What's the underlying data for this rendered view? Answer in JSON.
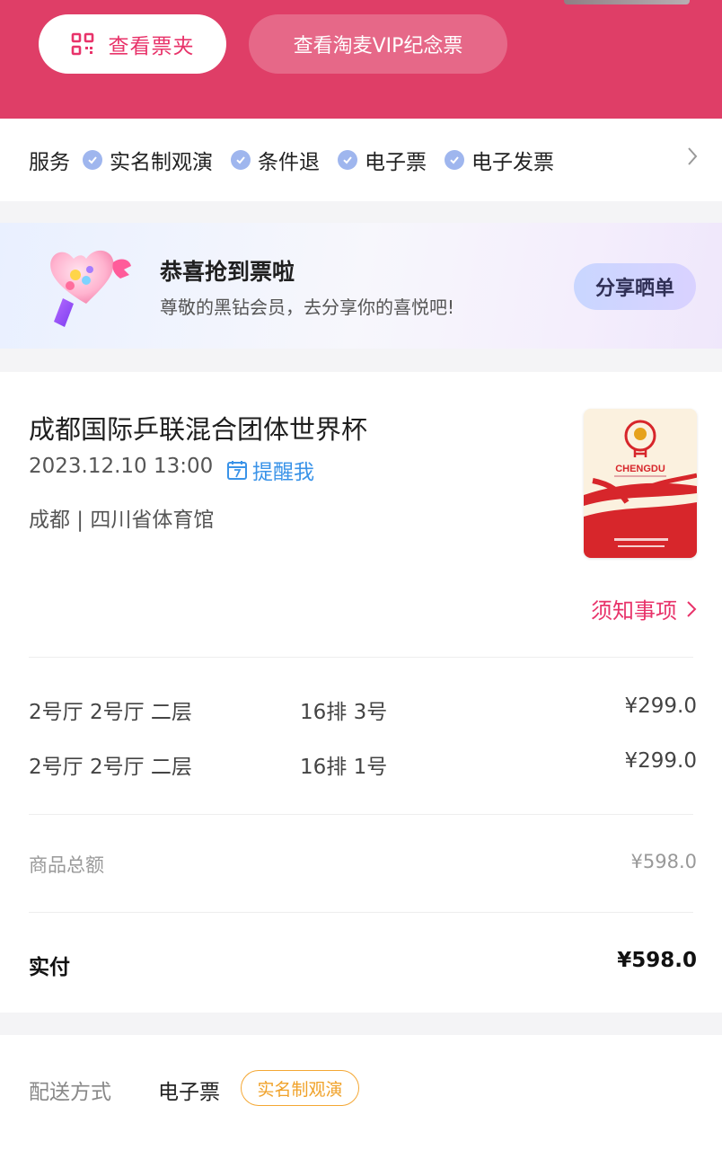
{
  "header": {
    "ticket_folder_label": "查看票夹",
    "vip_ticket_label": "查看淘麦VIP纪念票",
    "accent_color": "#df3e67"
  },
  "services": {
    "label": "服务",
    "items": [
      "实名制观演",
      "条件退",
      "电子票",
      "电子发票"
    ]
  },
  "banner": {
    "title": "恭喜抢到票啦",
    "subtitle": "尊敬的黑钻会员，去分享你的喜悦吧!",
    "share_label": "分享晒单"
  },
  "event": {
    "title": "成都国际乒联混合团体世界杯",
    "datetime": "2023.12.10 13:00",
    "remind_label": "提醒我",
    "venue": "成都 | 四川省体育馆",
    "poster_city": "CHENGDU",
    "notice_label": "须知事项"
  },
  "seats": [
    {
      "area": "2号厅 2号厅  二层",
      "position": "16排 3号",
      "price": "¥299.0"
    },
    {
      "area": "2号厅 2号厅  二层",
      "position": "16排 1号",
      "price": "¥299.0"
    }
  ],
  "totals": {
    "subtotal_label": "商品总额",
    "subtotal_value": "¥598.0",
    "paid_label": "实付",
    "paid_value": "¥598.0"
  },
  "delivery": {
    "label": "配送方式",
    "value": "电子票",
    "tag": "实名制观演"
  }
}
